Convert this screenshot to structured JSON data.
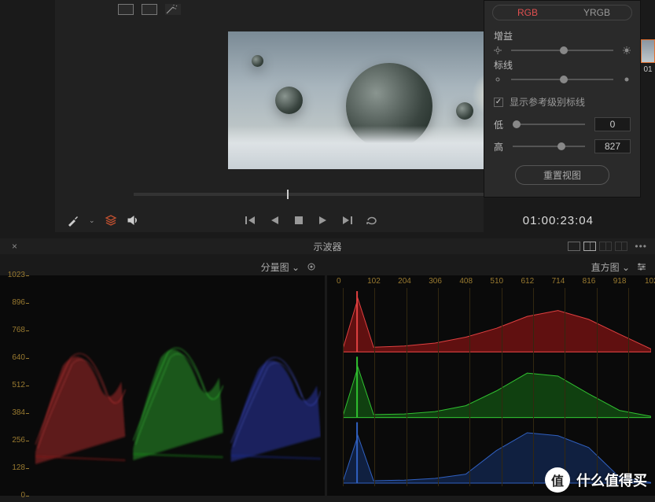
{
  "viewer": {
    "clip_thumb_label": "01"
  },
  "transport": {
    "timecode": "01:00:23:04"
  },
  "side_panel": {
    "tabs": {
      "rgb": "RGB",
      "yrgb": "YRGB",
      "active": "rgb"
    },
    "gain_label": "增益",
    "marker_label": "标线",
    "show_ref_label": "显示参考级别标线",
    "show_ref_checked": true,
    "low_label": "低",
    "low_value": "0",
    "high_label": "高",
    "high_value": "827",
    "reset_label": "重置视图"
  },
  "scopes": {
    "title": "示波器",
    "left_mode": "分量图",
    "right_mode": "直方图",
    "parade_yticks": [
      1023,
      896,
      768,
      640,
      512,
      384,
      256,
      128,
      0
    ],
    "hist_xticks": [
      0,
      102,
      204,
      306,
      408,
      510,
      612,
      714,
      816,
      918,
      1023
    ]
  },
  "watermark": {
    "circle": "值",
    "text": "什么值得买"
  },
  "icons": {
    "eyedropper": "eyedropper",
    "layers": "layers",
    "speaker": "speaker",
    "prev": "prev",
    "playrev": "playrev",
    "stop": "stop",
    "play": "play",
    "next": "next",
    "loop": "loop",
    "chevron": "⌄",
    "gear": "gear",
    "sun_small": "sun-small",
    "sun_big": "sun-big"
  },
  "chart_data": [
    {
      "type": "waveform-parade",
      "title": "分量图",
      "ylabel": "",
      "xlabel": "",
      "ylim": [
        0,
        1023
      ],
      "channels": [
        "R",
        "G",
        "B"
      ],
      "note": "RGB parade waveform; signal traces roughly span 128–768 per channel"
    },
    {
      "type": "histogram",
      "title": "直方图",
      "xlim": [
        0,
        1023
      ],
      "channels": [
        "R",
        "G",
        "B"
      ],
      "series": [
        {
          "name": "R",
          "x": [
            0,
            50,
            102,
            204,
            306,
            408,
            510,
            612,
            714,
            816,
            918,
            1023
          ],
          "values": [
            5,
            90,
            8,
            10,
            15,
            25,
            40,
            60,
            70,
            55,
            30,
            5
          ]
        },
        {
          "name": "G",
          "x": [
            0,
            50,
            102,
            204,
            306,
            408,
            510,
            612,
            714,
            816,
            918,
            1023
          ],
          "values": [
            2,
            85,
            5,
            6,
            10,
            20,
            45,
            75,
            70,
            40,
            12,
            2
          ]
        },
        {
          "name": "B",
          "x": [
            0,
            50,
            102,
            204,
            306,
            408,
            510,
            612,
            714,
            816,
            918,
            1023
          ],
          "values": [
            2,
            80,
            4,
            5,
            8,
            15,
            55,
            85,
            80,
            60,
            10,
            1
          ]
        }
      ]
    }
  ]
}
